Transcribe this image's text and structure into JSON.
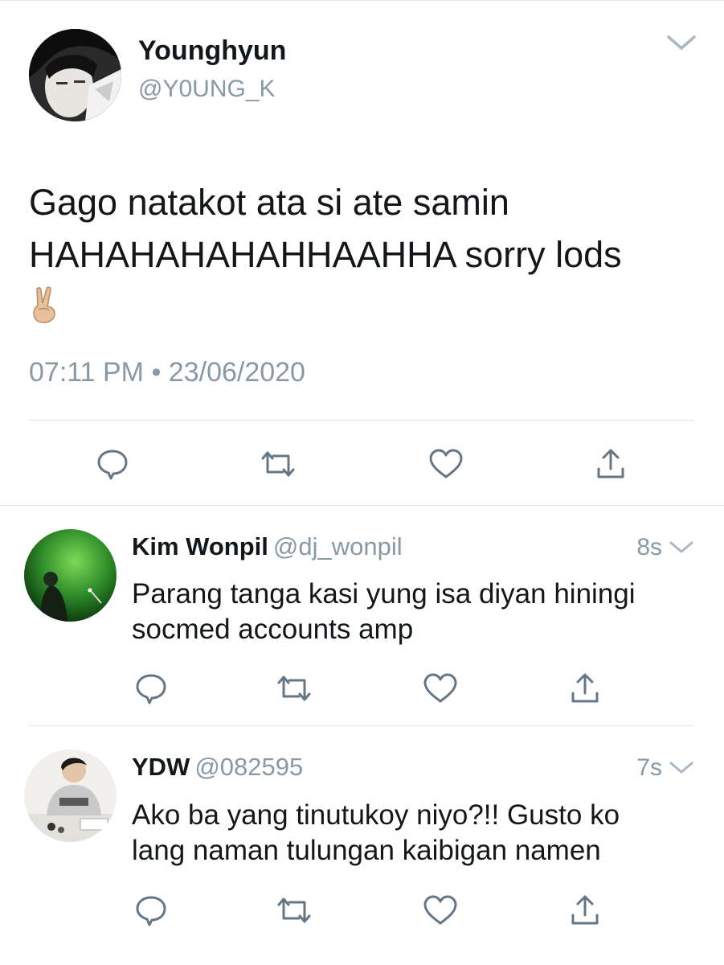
{
  "main_tweet": {
    "name": "Younghyun",
    "handle": "@Y0UNG_K",
    "text_line1": "Gago natakot ata si ate samin",
    "text_line2": "HAHAHAHAHAHHAAHHA sorry lods",
    "emoji": "✌🏼",
    "timestamp": "07:11 PM • 23/06/2020",
    "icons": [
      "chevron-down-icon",
      "reply-icon",
      "retweet-icon",
      "like-icon",
      "share-icon"
    ]
  },
  "replies": [
    {
      "name": "Kim Wonpil",
      "handle": "@dj_wonpil",
      "time": "8s",
      "text_line1": "Parang tanga kasi yung isa diyan hiningi",
      "text_line2": "socmed accounts amp"
    },
    {
      "name": "YDW",
      "handle": "@082595",
      "time": "7s",
      "text_line1": "Ako ba yang tinutukoy niyo?!! Gusto ko",
      "text_line2": "lang naman tulungan kaibigan namen"
    }
  ],
  "colors": {
    "text": "#14171a",
    "secondary": "#8899a6",
    "icon": "#657786",
    "divider": "#e1e8ed",
    "chevron": "#aab8c2"
  }
}
